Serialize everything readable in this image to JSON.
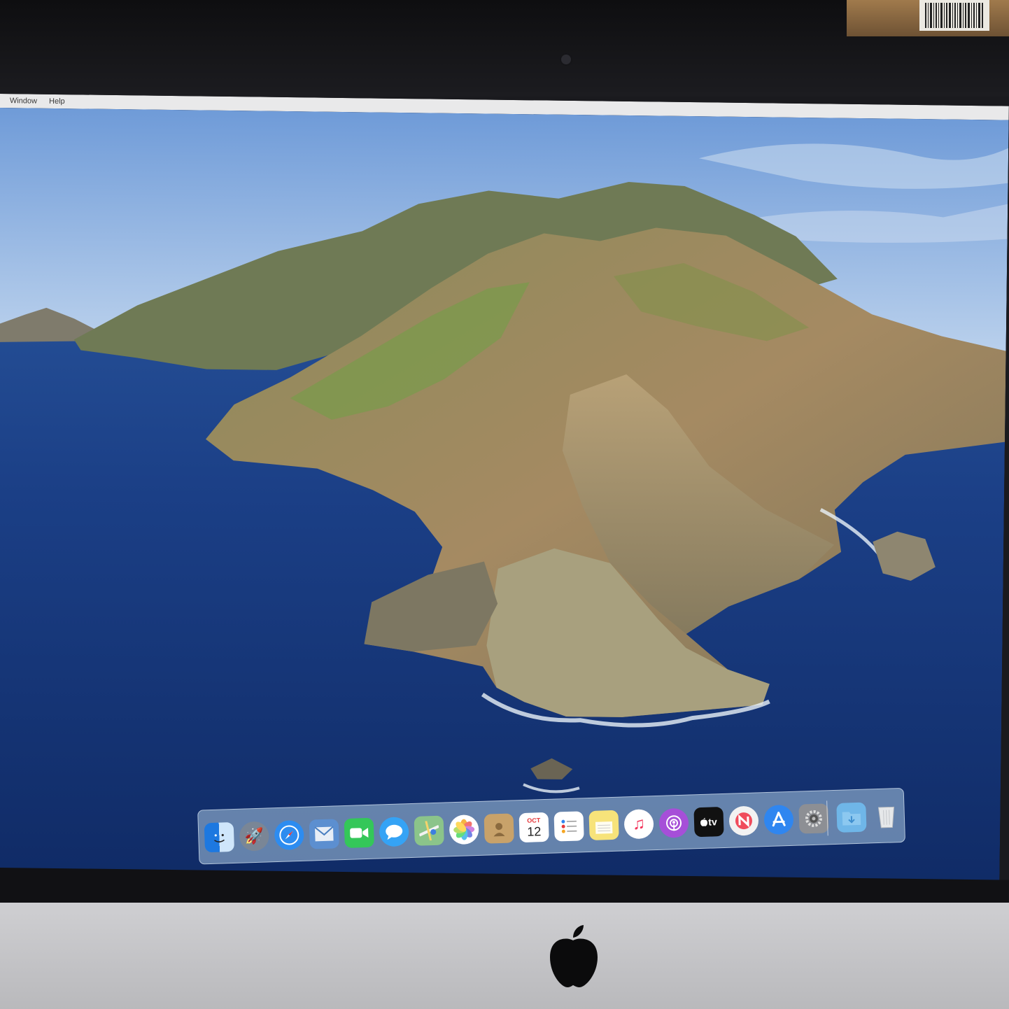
{
  "menubar": {
    "items": [
      "Window",
      "Help"
    ]
  },
  "calendar": {
    "month": "OCT",
    "day": "12"
  },
  "appletv": {
    "label": "tv"
  },
  "dock": {
    "apps": [
      {
        "name": "finder-icon",
        "color": "#3d8fe3"
      },
      {
        "name": "launchpad-icon",
        "color": "#7a8696"
      },
      {
        "name": "safari-icon",
        "color": "#2d8cf0"
      },
      {
        "name": "mail-icon",
        "color": "#5c8fd0"
      },
      {
        "name": "facetime-icon",
        "color": "#34c759"
      },
      {
        "name": "messages-icon",
        "color": "#35a3f5"
      },
      {
        "name": "maps-icon",
        "color": "#8bc48a"
      },
      {
        "name": "photos-icon",
        "color": "#ffffff"
      },
      {
        "name": "contacts-icon",
        "color": "#c8a26a"
      },
      {
        "name": "calendar-icon",
        "color": "#ffffff"
      },
      {
        "name": "reminders-icon",
        "color": "#ffffff"
      },
      {
        "name": "notes-icon",
        "color": "#f7e37a"
      },
      {
        "name": "music-icon",
        "color": "#ffffff"
      },
      {
        "name": "podcasts-icon",
        "color": "#a64fd8"
      },
      {
        "name": "appletv-icon",
        "color": "#111111"
      },
      {
        "name": "news-icon",
        "color": "#f2f2f2"
      },
      {
        "name": "app-store-icon",
        "color": "#2f86f0"
      },
      {
        "name": "system-preferences-icon",
        "color": "#8d8f94"
      },
      {
        "name": "downloads-folder-icon",
        "color": "#6fb6e8"
      },
      {
        "name": "trash-icon",
        "color": "#e6e8ea"
      }
    ]
  }
}
